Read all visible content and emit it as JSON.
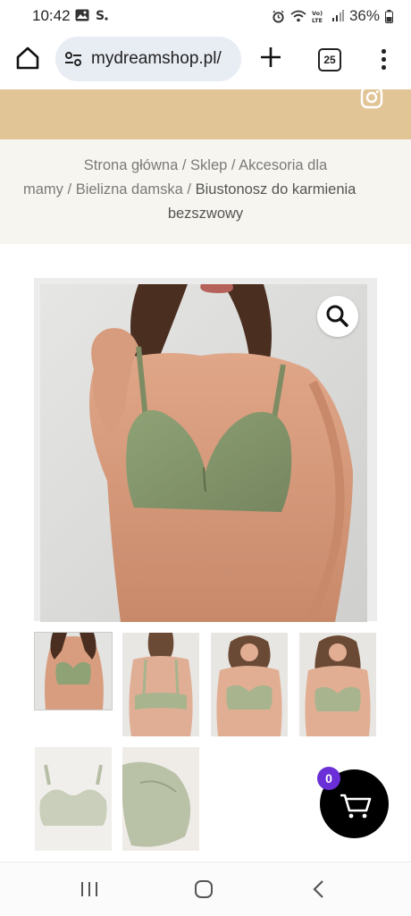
{
  "status_bar": {
    "time": "10:42",
    "battery": "36%",
    "icons": [
      "image-icon",
      "s-icon",
      "alarm-icon",
      "wifi-icon",
      "volte-icon",
      "signal-icon",
      "battery-icon"
    ]
  },
  "browser": {
    "url": "mydreamshop.pl/",
    "tab_count": "25",
    "icons": [
      "home-icon",
      "site-settings-icon",
      "new-tab-icon",
      "tabs-icon",
      "more-menu-icon"
    ]
  },
  "header": {
    "band_color": "#e2c597",
    "icons": [
      "instagram-icon"
    ]
  },
  "breadcrumb": {
    "home": "Strona główna",
    "shop": "Sklep",
    "accessories_part1": "Akcesoria dla",
    "accessories_part2": "mamy",
    "lingerie": "Bielizna damska",
    "current_part1": "Biustonosz do karmienia",
    "current_part2": "bezszwowy",
    "separator": " / "
  },
  "gallery": {
    "product_color": "#8e9f73",
    "thumbnail_count": 6,
    "icons": [
      "zoom-icon"
    ]
  },
  "cart": {
    "count": "0",
    "badge_color": "#6a2fd6",
    "icons": [
      "cart-icon"
    ]
  },
  "nav": {
    "icons": [
      "recents-icon",
      "home-nav-icon",
      "back-icon"
    ]
  }
}
